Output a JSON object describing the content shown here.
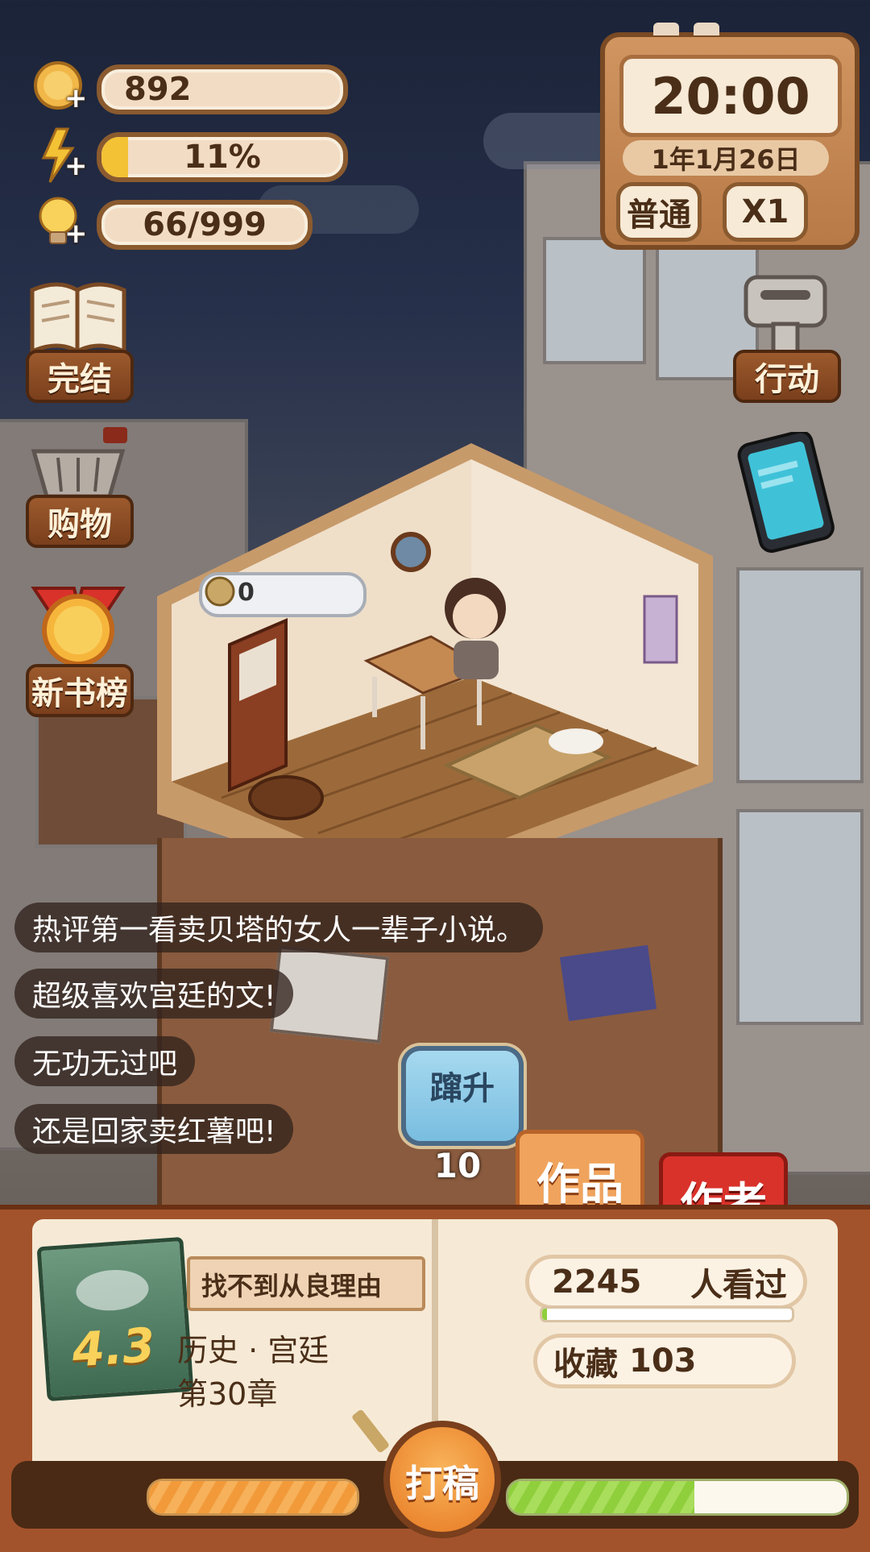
{
  "resources": {
    "coins": {
      "value": "892",
      "icon": "coin-icon"
    },
    "energy": {
      "value": "11%",
      "fill_fraction": 0.11,
      "icon": "lightning-icon"
    },
    "ideas": {
      "value": "66/999",
      "icon": "lightbulb-icon"
    },
    "plus_symbol": "+"
  },
  "clock": {
    "time": "20:00",
    "date": "1年1月26日",
    "mode_label": "普通",
    "speed_label": "X1"
  },
  "left_menu": [
    {
      "label": "完结",
      "icon": "open-book-icon"
    },
    {
      "label": "购物",
      "icon": "shopping-basket-icon"
    },
    {
      "label": "新书榜",
      "icon": "medal-icon"
    }
  ],
  "right_menu": {
    "action_label": "行动",
    "action_icon": "key-icon",
    "tablet_icon": "tablet-icon"
  },
  "room": {
    "coin_bubble_value": "0"
  },
  "comments": [
    "热评第一看卖贝塔的女人一辈子小说。",
    "超级喜欢宫廷的文!",
    "无功无过吧",
    "还是回家卖红薯吧!"
  ],
  "boost": {
    "label": "蹿升",
    "count": "10"
  },
  "tabs": {
    "works": "作品",
    "author": "作者"
  },
  "book": {
    "rating": "4.3",
    "title": "找不到从良理由",
    "genre": "历史 · 宫廷",
    "chapter": "第30章",
    "views_count": "2245",
    "views_label": "人看过",
    "views_progress": 0.02,
    "favorites_label": "收藏",
    "favorites_count": "103",
    "write_button": "打稿",
    "left_progress": 1.0,
    "right_progress": 0.55
  },
  "colors": {
    "wood_dark": "#7a3f1c",
    "panel_cream": "#f7ead6",
    "progress_orange": "#f29a3a",
    "progress_green": "#8fcf3c",
    "boost_blue": "#8cc9e6",
    "tab_works": "#f0a35c",
    "tab_author": "#d9322b"
  }
}
